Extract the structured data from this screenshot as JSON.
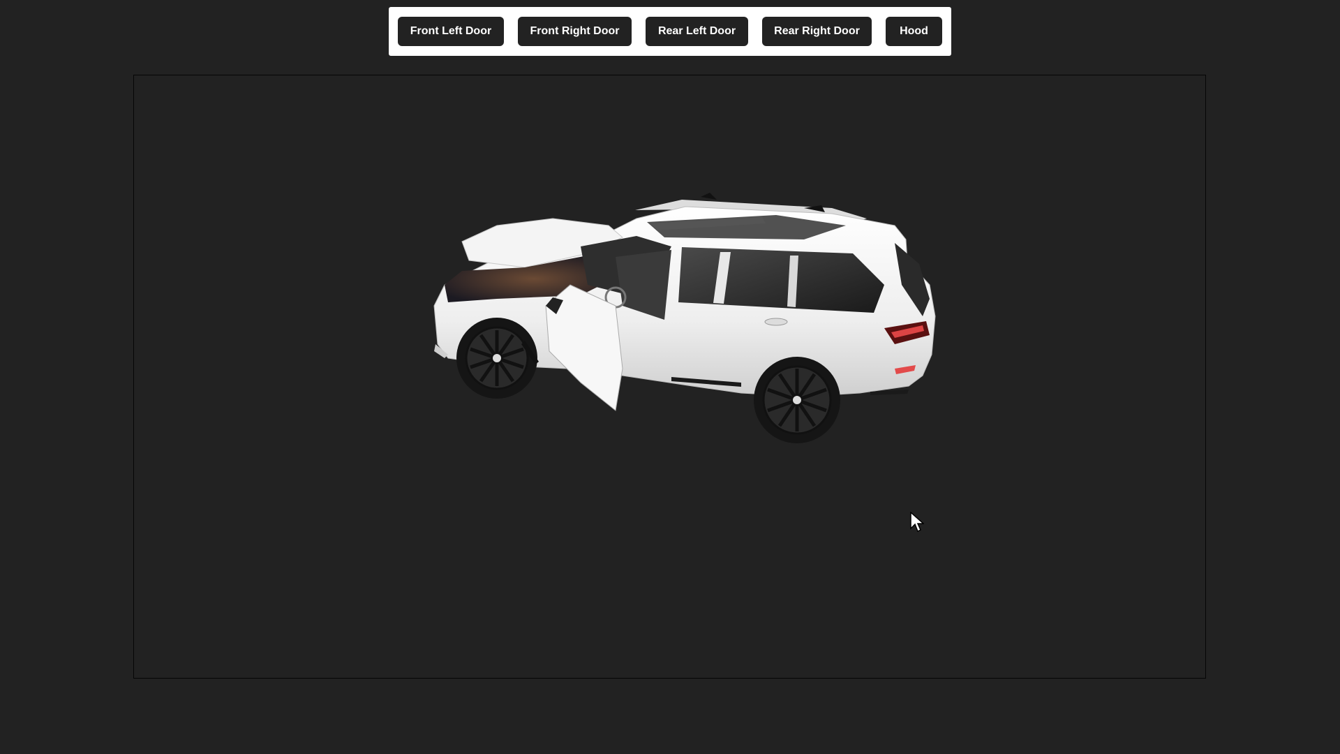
{
  "toolbar": {
    "buttons": [
      {
        "label": "Front Left Door"
      },
      {
        "label": "Front Right Door"
      },
      {
        "label": "Rear Left Door"
      },
      {
        "label": "Rear Right Door"
      },
      {
        "label": "Hood"
      }
    ]
  },
  "viewport": {
    "model": {
      "icon": "suv-3d-model",
      "body_color": "#f2f2f2",
      "state": {
        "hood": "open",
        "front_left_door": "open"
      }
    }
  },
  "cursor": {
    "icon": "arrow-cursor"
  },
  "colors": {
    "background": "#222222",
    "toolbar_bg": "#ffffff",
    "button_bg": "#222222",
    "button_text": "#ffffff"
  }
}
